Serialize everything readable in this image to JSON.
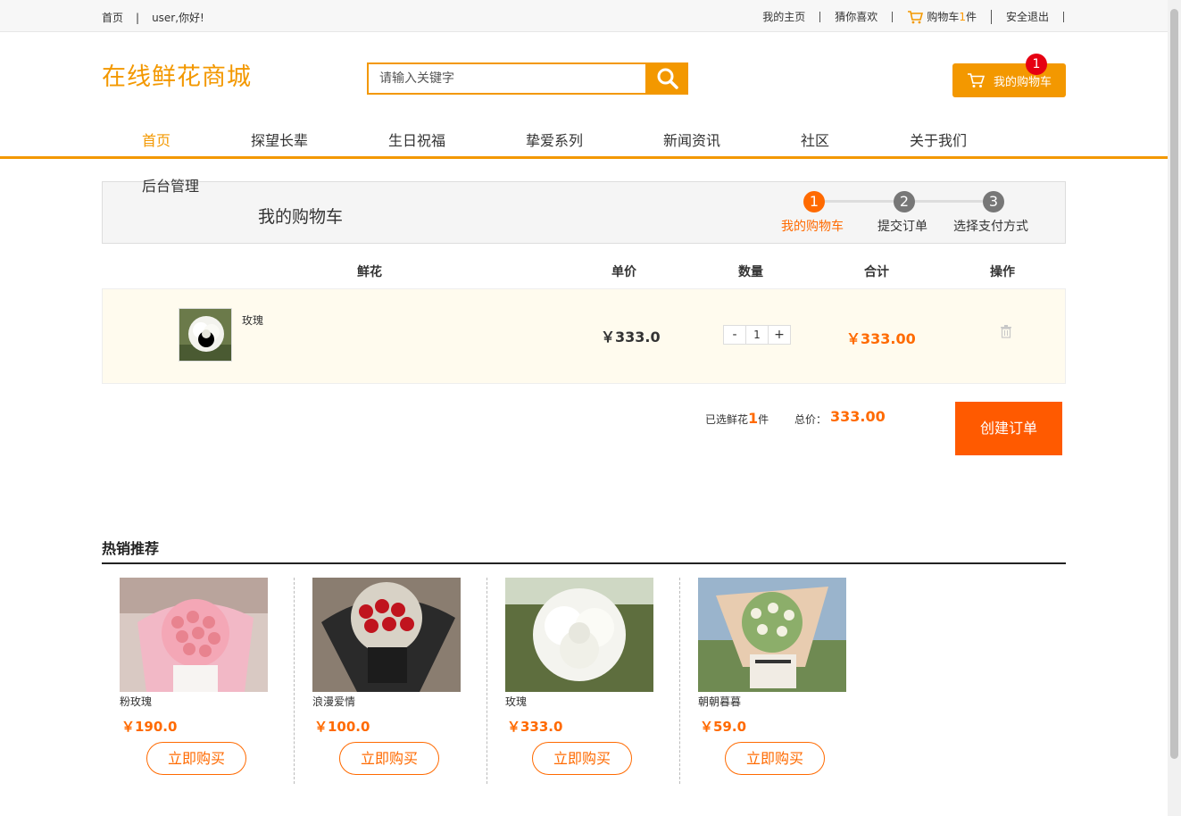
{
  "topbar": {
    "home": "首页",
    "separator": "|",
    "greeting": "user,你好!",
    "my_home": "我的主页",
    "guess": "猜你喜欢",
    "cart_prefix": "购物车",
    "cart_count": "1",
    "cart_suffix": "件",
    "logout": "安全退出"
  },
  "header": {
    "logo": "在线鲜花商城",
    "search_placeholder": "请输入关键字",
    "cart_button": "我的购物车",
    "cart_badge": "1"
  },
  "nav": {
    "items": [
      "首页",
      "探望长辈",
      "生日祝福",
      "挚爱系列",
      "新闻资讯",
      "社区",
      "关于我们"
    ],
    "admin": "后台管理"
  },
  "cart_panel": {
    "title": "我的购物车",
    "steps": [
      {
        "num": "1",
        "label": "我的购物车"
      },
      {
        "num": "2",
        "label": "提交订单"
      },
      {
        "num": "3",
        "label": "选择支付方式"
      }
    ]
  },
  "table": {
    "headers": [
      "鲜花",
      "单价",
      "数量",
      "合计",
      "操作"
    ],
    "rows": [
      {
        "name": "玫瑰",
        "price": "￥333.0",
        "qty_minus": "-",
        "qty": "1",
        "qty_plus": "+",
        "total": "￥333.00"
      }
    ]
  },
  "summary": {
    "selected_prefix": "已选鲜花",
    "selected_count": "1",
    "selected_suffix": "件",
    "total_label": "总价：",
    "total_value": "333.00",
    "create_order": "创建订单"
  },
  "hot": {
    "title": "热销推荐",
    "products": [
      {
        "name": "粉玫瑰",
        "price": "￥190.0",
        "buy": "立即购买"
      },
      {
        "name": "浪漫爱情",
        "price": "￥100.0",
        "buy": "立即购买"
      },
      {
        "name": "玫瑰",
        "price": "￥333.0",
        "buy": "立即购买"
      },
      {
        "name": "朝朝暮暮",
        "price": "￥59.0",
        "buy": "立即购买"
      }
    ]
  },
  "colors": {
    "accent": "#f39800",
    "price": "#ff6a00",
    "create_button": "#ff5a00",
    "badge": "#e60012"
  }
}
